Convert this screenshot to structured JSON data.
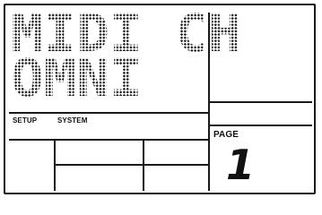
{
  "display": {
    "line1": "MIDI CH",
    "line2": "OMNI"
  },
  "labels": {
    "setup": "SETUP",
    "system": "SYSTEM",
    "page": "PAGE"
  },
  "page_number": "1",
  "colors": {
    "segment": "#1a1a1a",
    "background": "#ffffff"
  }
}
